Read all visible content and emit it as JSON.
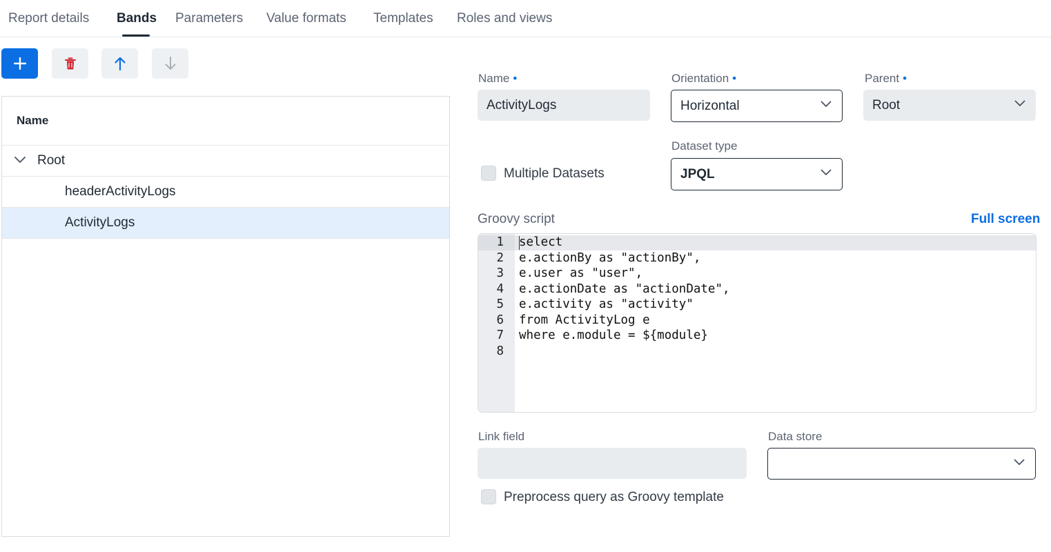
{
  "tabs": [
    {
      "label": "Report details",
      "active": false
    },
    {
      "label": "Bands",
      "active": true
    },
    {
      "label": "Parameters",
      "active": false
    },
    {
      "label": "Value formats",
      "active": false
    },
    {
      "label": "Templates",
      "active": false
    },
    {
      "label": "Roles and views",
      "active": false
    }
  ],
  "toolbar": {
    "add_icon": "plus-icon",
    "delete_icon": "trash-icon",
    "move_up_icon": "arrow-up-icon",
    "move_down_icon": "arrow-down-icon"
  },
  "tree": {
    "column_header": "Name",
    "rows": [
      {
        "label": "Root",
        "level": 0,
        "expanded": true,
        "selected": false
      },
      {
        "label": "headerActivityLogs",
        "level": 1,
        "selected": false
      },
      {
        "label": "ActivityLogs",
        "level": 1,
        "selected": true
      }
    ]
  },
  "form": {
    "name": {
      "label": "Name",
      "value": "ActivityLogs"
    },
    "orientation": {
      "label": "Orientation",
      "value": "Horizontal"
    },
    "parent": {
      "label": "Parent",
      "value": "Root"
    },
    "dataset_type": {
      "label": "Dataset type",
      "value": "JPQL"
    },
    "multiple_datasets": {
      "label": "Multiple Datasets",
      "checked": false
    },
    "script": {
      "label": "Groovy script",
      "full_screen": "Full screen",
      "lines": [
        {
          "n": "1",
          "text": "select"
        },
        {
          "n": "2",
          "text": "e.actionBy as \"actionBy\","
        },
        {
          "n": "3",
          "text": "e.user as \"user\","
        },
        {
          "n": "4",
          "text": "e.actionDate as \"actionDate\","
        },
        {
          "n": "5",
          "text": "e.activity as \"activity\""
        },
        {
          "n": "6",
          "text": "from ActivityLog e"
        },
        {
          "n": "7",
          "text": "where e.module = ${module}"
        },
        {
          "n": "8",
          "text": ""
        }
      ]
    },
    "link_field": {
      "label": "Link field",
      "value": ""
    },
    "data_store": {
      "label": "Data store",
      "value": ""
    },
    "preprocess": {
      "label": "Preprocess query as Groovy template",
      "checked": false
    }
  },
  "colors": {
    "accent": "#0b6ee3",
    "danger": "#d1242f",
    "selected_row": "#e3effc"
  }
}
